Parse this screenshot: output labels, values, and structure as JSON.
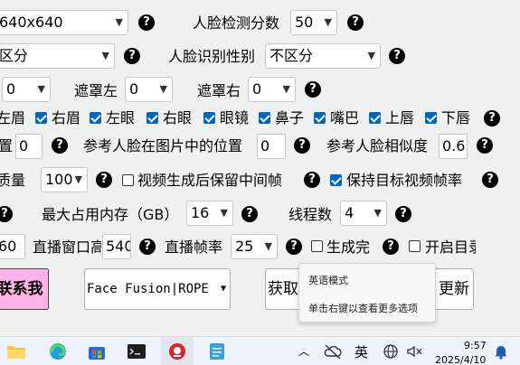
{
  "row1": {
    "resolution_select": "640x640",
    "face_score_label": "人脸检测分数",
    "face_score_value": "50"
  },
  "row2": {
    "gender_select_left": "区分",
    "face_gender_label": "人脸识别性别",
    "face_gender_value": "不区分"
  },
  "row3": {
    "left_value": "0",
    "mask_left_label": "遮罩左",
    "mask_left_value": "0",
    "mask_right_label": "遮罩右",
    "mask_right_value": "0"
  },
  "row4": {
    "items": [
      {
        "label": "左眉",
        "checked": true
      },
      {
        "label": "右眉",
        "checked": true
      },
      {
        "label": "左眼",
        "checked": true
      },
      {
        "label": "右眼",
        "checked": true
      },
      {
        "label": "眼镜",
        "checked": true
      },
      {
        "label": "鼻子",
        "checked": true
      },
      {
        "label": "嘴巴",
        "checked": true
      },
      {
        "label": "上唇",
        "checked": true
      },
      {
        "label": "下唇",
        "checked": true
      }
    ]
  },
  "row5": {
    "partial_label": "置",
    "first_value": "0",
    "ref_pos_label": "参考人脸在图片中的位置",
    "ref_pos_value": "0",
    "ref_sim_label": "参考人脸相似度",
    "ref_sim_value": "0.6"
  },
  "row6": {
    "quality_label": "质量",
    "quality_value": "100",
    "keep_frames_label": "视频生成后保留中间帧",
    "keep_frames_checked": false,
    "keep_fps_label": "保持目标视频帧率",
    "keep_fps_checked": true
  },
  "row7": {
    "max_mem_label": "最大占用内存（GB）",
    "max_mem_value": "16",
    "threads_label": "线程数",
    "threads_value": "4"
  },
  "row8": {
    "first_value": "60",
    "live_window_label": "直播窗口高",
    "live_window_value": "540",
    "live_fps_label": "直播帧率",
    "live_fps_value": "25",
    "generate_done_label": "生成完",
    "open_dir_label": "开启目录"
  },
  "buttons": {
    "contact": "联系我",
    "engine_select": "Face Fusion|ROPE",
    "fetch": "获取",
    "update": "更新"
  },
  "tooltip": {
    "title": "英语模式",
    "hint": "单击右键以查看更多选项"
  },
  "taskbar": {
    "ime": "英",
    "time": "9:57",
    "date": "2025/4/10"
  },
  "colors": {
    "contact_button": "#ffb3e6",
    "checkbox_accent": "#0067c0",
    "taskbar_bg": "#eef3f9"
  }
}
